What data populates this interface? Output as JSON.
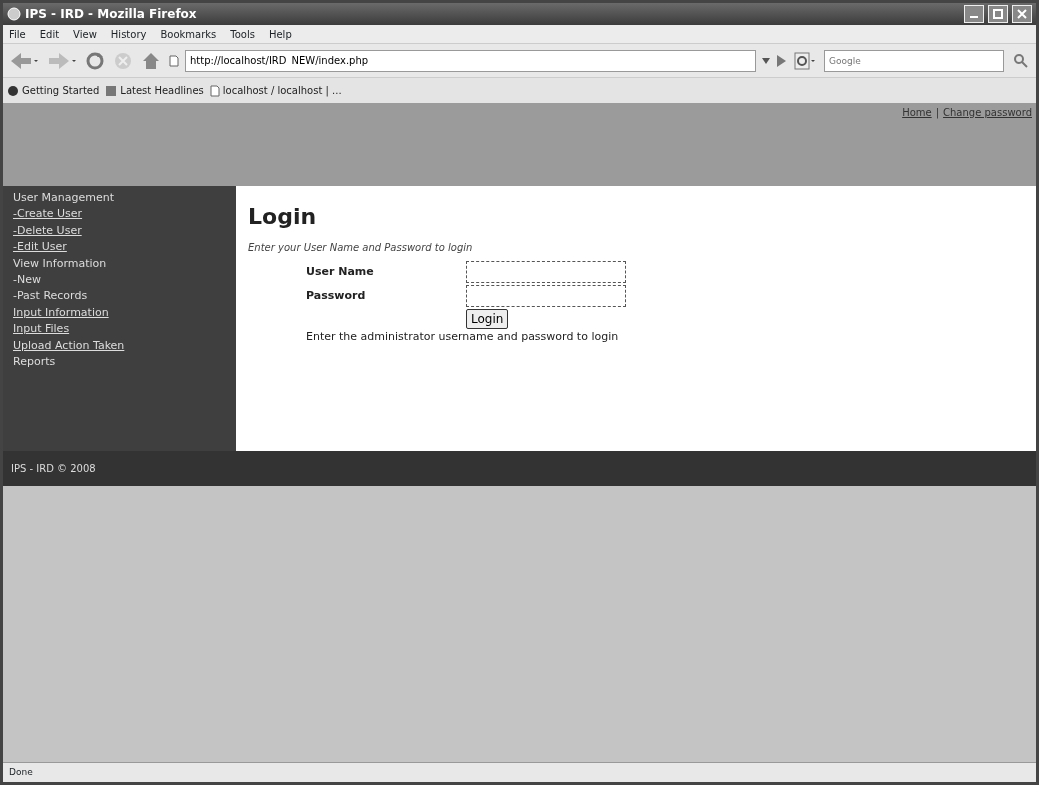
{
  "window": {
    "title": "IPS - IRD - Mozilla Firefox"
  },
  "menu": [
    "File",
    "Edit",
    "View",
    "History",
    "Bookmarks",
    "Tools",
    "Help"
  ],
  "address": {
    "value": "http://localhost/IRD_NEW/index.php"
  },
  "search": {
    "placeholder": "Google"
  },
  "bookmarks": [
    {
      "label": "Getting Started",
      "kind": "start"
    },
    {
      "label": "Latest Headlines",
      "kind": "feed"
    },
    {
      "label": "localhost / localhost | ...",
      "kind": "page"
    }
  ],
  "header_links": [
    {
      "label": "Home"
    },
    {
      "label": "Change password"
    }
  ],
  "header_separator": "|",
  "sidebar": {
    "items": [
      {
        "label": "User Management",
        "kind": "heading"
      },
      {
        "label": "-Create User",
        "kind": "link"
      },
      {
        "label": "-Delete User",
        "kind": "link"
      },
      {
        "label": "-Edit User",
        "kind": "link"
      },
      {
        "label": "View Information",
        "kind": "heading"
      },
      {
        "label": "-New",
        "kind": "heading"
      },
      {
        "label": "-Past Records",
        "kind": "heading"
      },
      {
        "label": "Input Information",
        "kind": "link"
      },
      {
        "label": "Input Files",
        "kind": "link"
      },
      {
        "label": "Upload Action Taken",
        "kind": "link"
      },
      {
        "label": "Reports",
        "kind": "heading"
      }
    ]
  },
  "login": {
    "title": "Login",
    "intro": "Enter your User Name and Password to login",
    "fields": [
      {
        "label": "User Name"
      },
      {
        "label": "Password"
      }
    ],
    "button": "Login",
    "note": "Enter the administrator username and password to login"
  },
  "footer": "IPS - IRD © 2008",
  "status_bar": "Done"
}
